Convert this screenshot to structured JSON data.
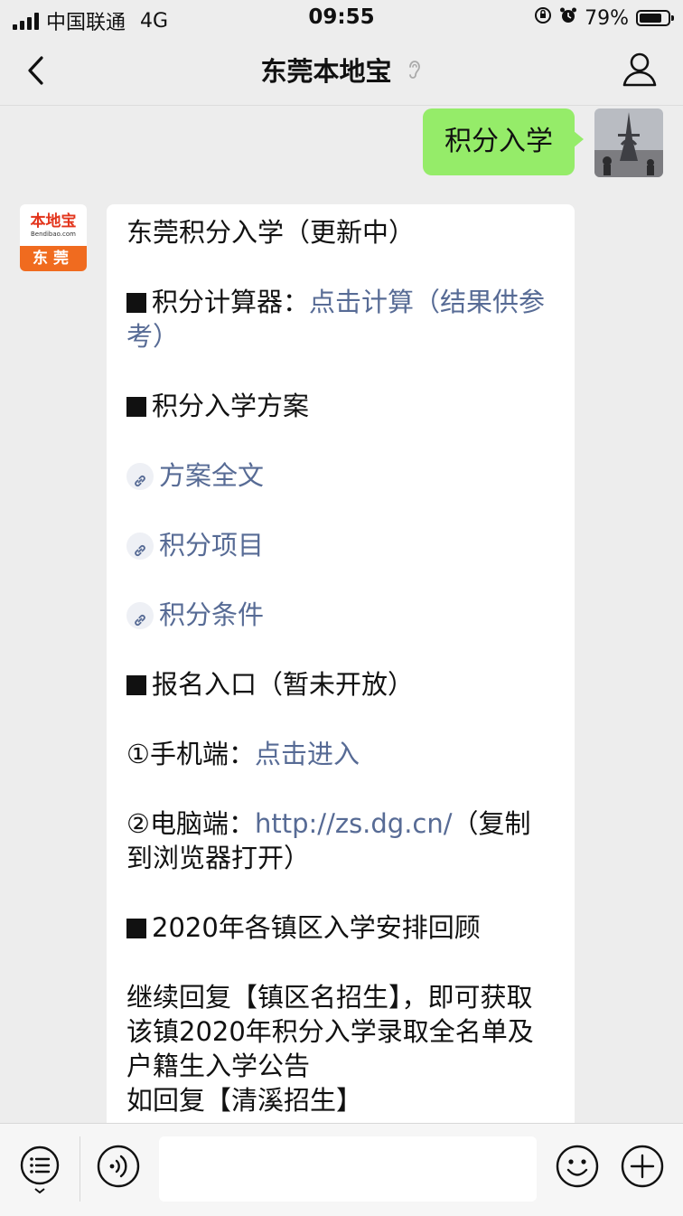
{
  "status_bar": {
    "carrier": "中国联通",
    "network": "4G",
    "time": "09:55",
    "battery": "79%",
    "battery_level": 0.79
  },
  "nav": {
    "title": "东莞本地宝",
    "ear_icon": "ear-icon",
    "back_icon": "chevron-left-icon",
    "profile_icon": "person-icon"
  },
  "messages": {
    "user": {
      "text": "积分入学"
    },
    "bot": {
      "avatar_brand": "本地宝",
      "avatar_url": "Bendibao.com",
      "avatar_city": "东莞",
      "title": "东莞积分入学（更新中）",
      "calc_label": "积分计算器：",
      "calc_link": "点击计算（结果供参考）",
      "plan_heading": "积分入学方案",
      "link_full_text": "方案全文",
      "link_items": "积分项目",
      "link_conditions": "积分条件",
      "signup_heading": "报名入口（暂未开放）",
      "mobile_label": "①手机端：",
      "mobile_link": "点击进入",
      "pc_label": "②电脑端：",
      "pc_link": "http://zs.dg.cn/",
      "pc_note": "（复制到浏览器打开）",
      "review_heading": "2020年各镇区入学安排回顾",
      "reply_text": "继续回复【镇区名招生】，即可获取该镇2020年积分入学录取全名单及户籍生入学公告",
      "example_text": "如回复【清溪招生】"
    }
  },
  "toolbar": {
    "menu_icon": "menu-list-icon",
    "voice_icon": "voice-icon",
    "input_value": "",
    "emoji_icon": "emoji-icon",
    "add_icon": "plus-circle-icon"
  }
}
